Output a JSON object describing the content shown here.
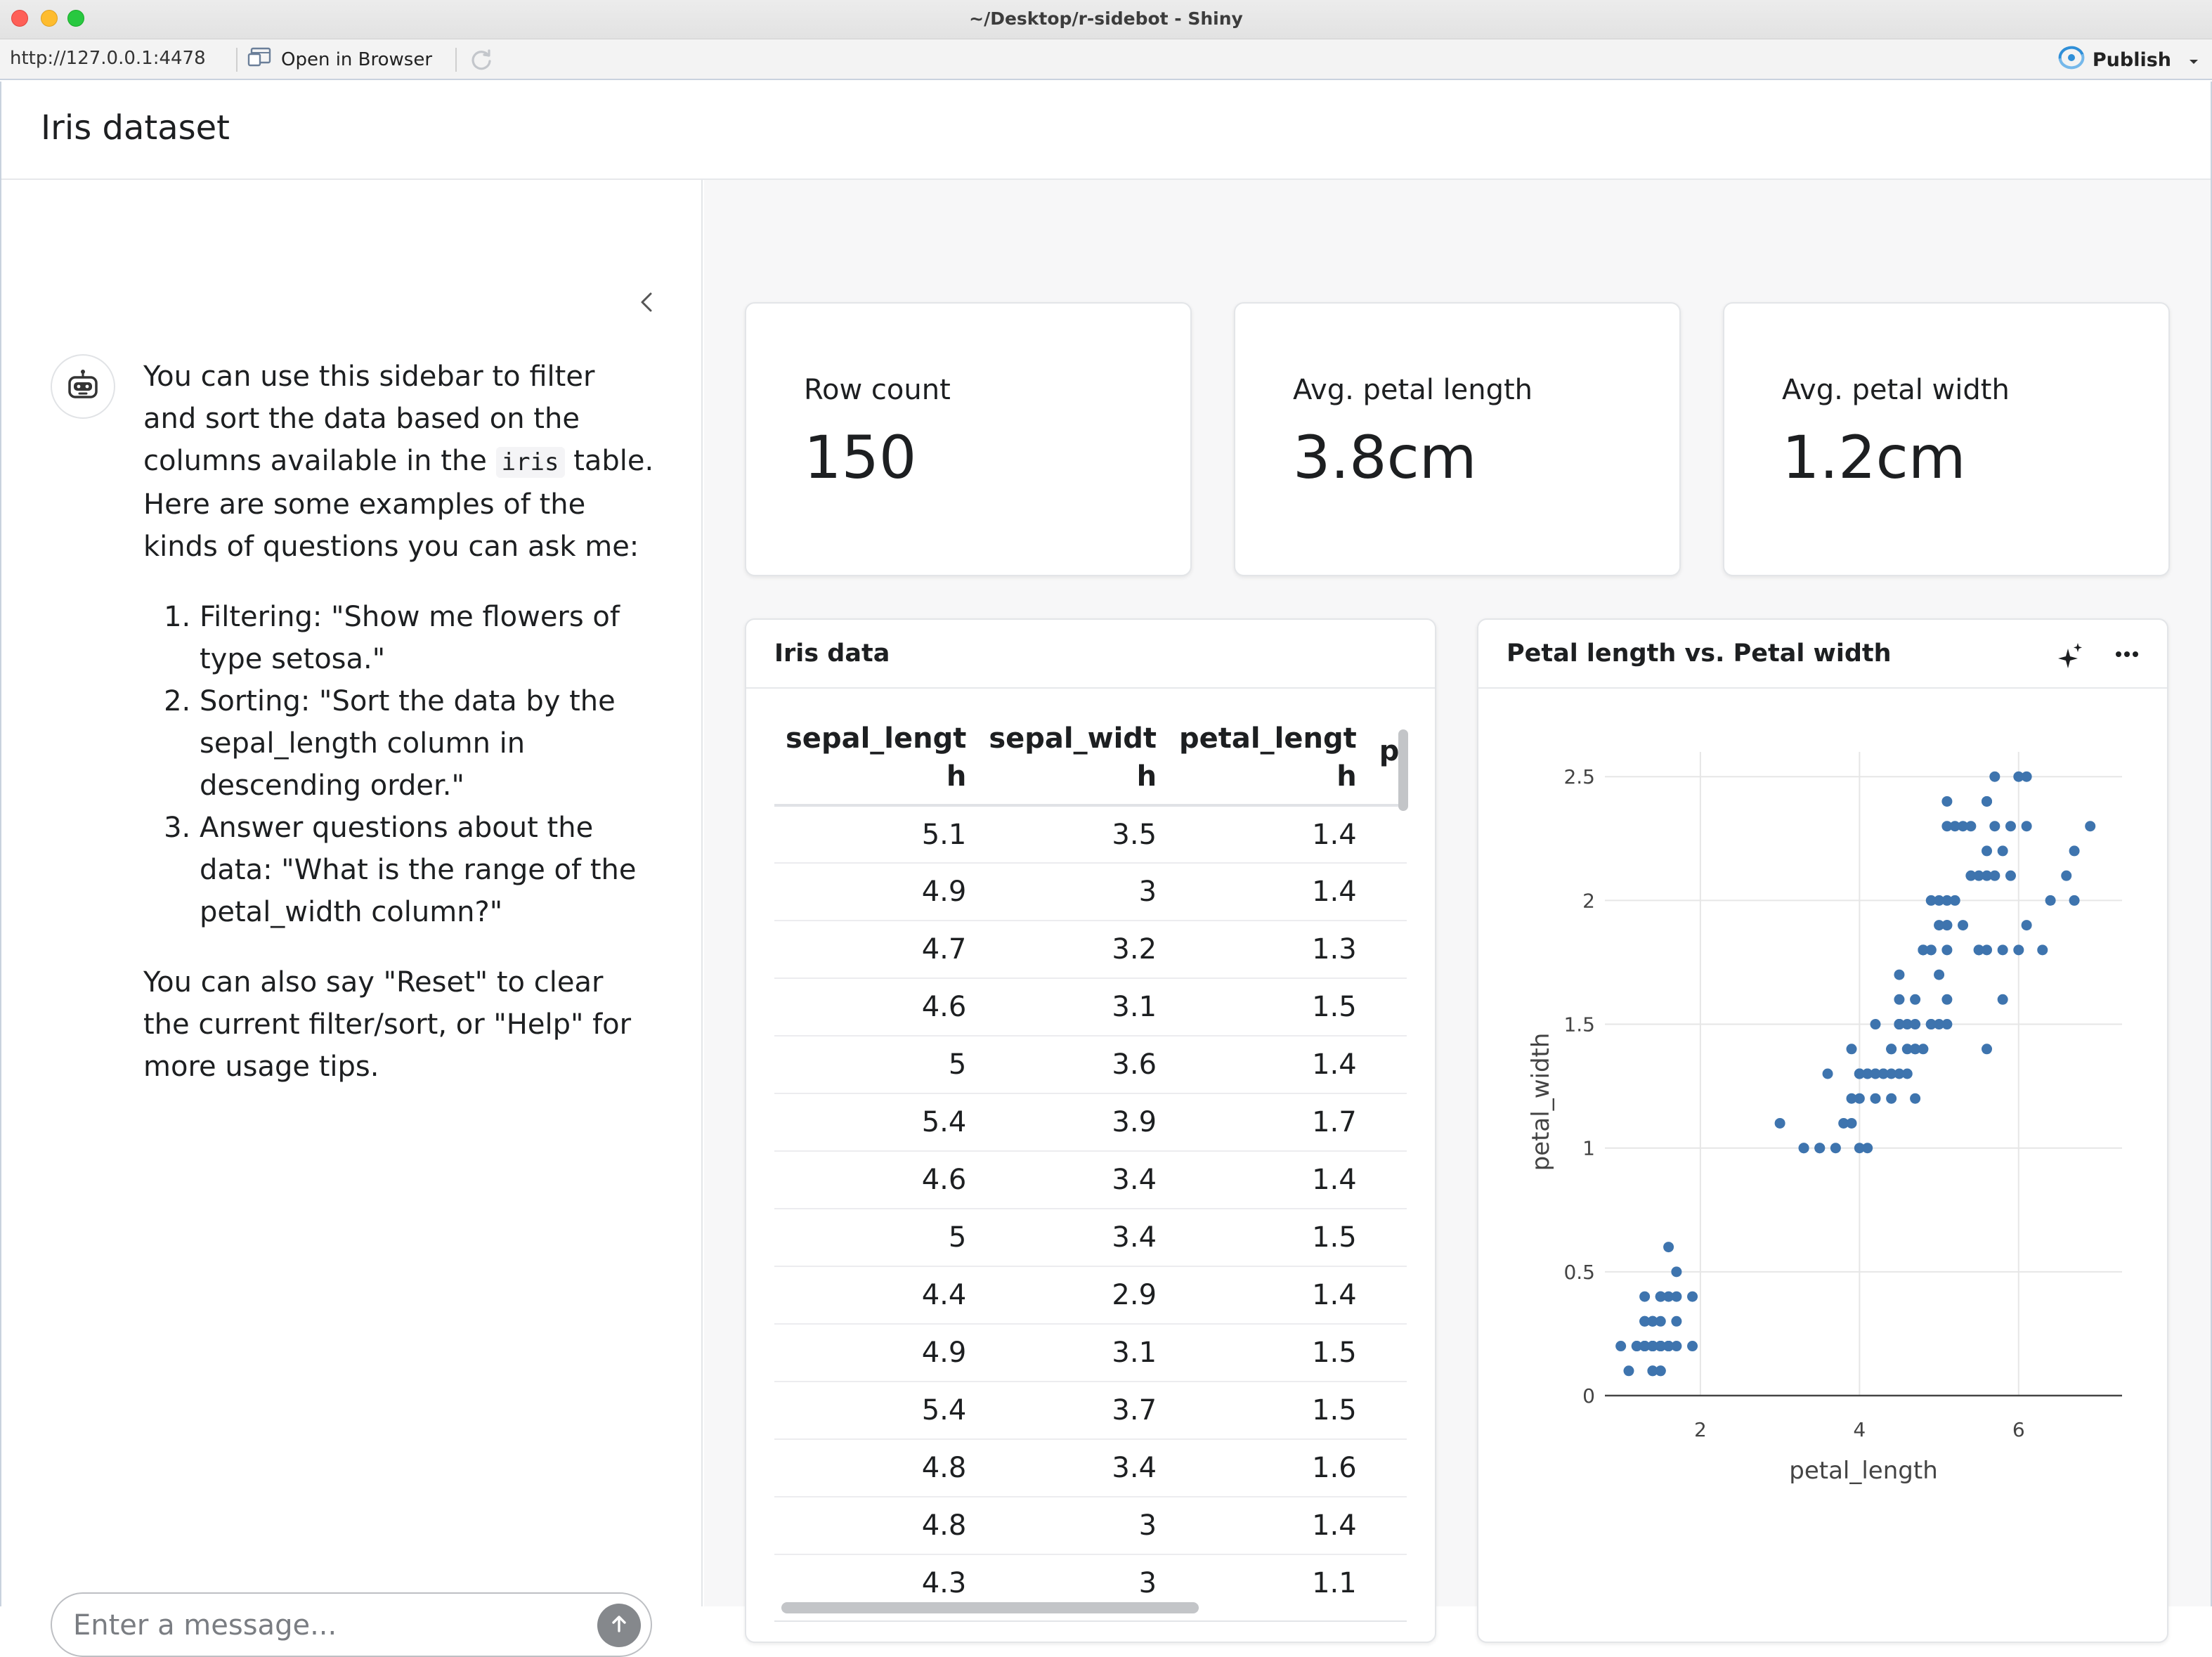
{
  "window": {
    "title": "~/Desktop/r-sidebot - Shiny"
  },
  "toolbar": {
    "url": "http://127.0.0.1:4478",
    "open_in_browser": "Open in Browser",
    "publish": "Publish"
  },
  "app": {
    "title": "Iris dataset"
  },
  "chat": {
    "intro_before": "You can use this sidebar to filter and sort the data based on the columns available in the ",
    "intro_code": "iris",
    "intro_after": " table. Here are some examples of the kinds of questions you can ask me:",
    "examples": [
      "Filtering: \"Show me flowers of type setosa.\"",
      "Sorting: \"Sort the data by the sepal_length column in descending order.\"",
      "Answer questions about the data: \"What is the range of the petal_width column?\""
    ],
    "outro": "You can also say \"Reset\" to clear the current filter/sort, or \"Help\" for more usage tips.",
    "input_placeholder": "Enter a message..."
  },
  "value_boxes": [
    {
      "label": "Row count",
      "value": "150"
    },
    {
      "label": "Avg. petal length",
      "value": "3.8cm"
    },
    {
      "label": "Avg. petal width",
      "value": "1.2cm"
    }
  ],
  "table": {
    "title": "Iris data",
    "columns": [
      "sepal_length",
      "sepal_width",
      "petal_length",
      "peta"
    ],
    "rows": [
      [
        "5.1",
        "3.5",
        "1.4"
      ],
      [
        "4.9",
        "3",
        "1.4"
      ],
      [
        "4.7",
        "3.2",
        "1.3"
      ],
      [
        "4.6",
        "3.1",
        "1.5"
      ],
      [
        "5",
        "3.6",
        "1.4"
      ],
      [
        "5.4",
        "3.9",
        "1.7"
      ],
      [
        "4.6",
        "3.4",
        "1.4"
      ],
      [
        "5",
        "3.4",
        "1.5"
      ],
      [
        "4.4",
        "2.9",
        "1.4"
      ],
      [
        "4.9",
        "3.1",
        "1.5"
      ],
      [
        "5.4",
        "3.7",
        "1.5"
      ],
      [
        "4.8",
        "3.4",
        "1.6"
      ],
      [
        "4.8",
        "3",
        "1.4"
      ],
      [
        "4.3",
        "3",
        "1.1"
      ]
    ]
  },
  "colors": {
    "point": "#3e74ae",
    "accent": "#2a8bd6"
  },
  "chart_data": {
    "type": "scatter",
    "title": "Petal length vs. Petal width",
    "xlabel": "petal_length",
    "ylabel": "petal_width",
    "xlim": [
      0.8,
      7.3
    ],
    "ylim": [
      0,
      2.6
    ],
    "xticks": [
      2,
      4,
      6
    ],
    "yticks": [
      0,
      0.5,
      1,
      1.5,
      2,
      2.5
    ],
    "grid": true,
    "points": [
      [
        1.4,
        0.2
      ],
      [
        1.4,
        0.2
      ],
      [
        1.3,
        0.2
      ],
      [
        1.5,
        0.2
      ],
      [
        1.4,
        0.2
      ],
      [
        1.7,
        0.4
      ],
      [
        1.4,
        0.3
      ],
      [
        1.5,
        0.2
      ],
      [
        1.4,
        0.2
      ],
      [
        1.5,
        0.1
      ],
      [
        1.5,
        0.2
      ],
      [
        1.6,
        0.2
      ],
      [
        1.4,
        0.1
      ],
      [
        1.1,
        0.1
      ],
      [
        1.2,
        0.2
      ],
      [
        1.5,
        0.4
      ],
      [
        1.3,
        0.4
      ],
      [
        1.4,
        0.3
      ],
      [
        1.7,
        0.3
      ],
      [
        1.5,
        0.3
      ],
      [
        1.7,
        0.2
      ],
      [
        1.5,
        0.4
      ],
      [
        1.0,
        0.2
      ],
      [
        1.7,
        0.5
      ],
      [
        1.9,
        0.2
      ],
      [
        1.6,
        0.2
      ],
      [
        1.6,
        0.4
      ],
      [
        1.5,
        0.2
      ],
      [
        1.4,
        0.2
      ],
      [
        1.6,
        0.2
      ],
      [
        1.6,
        0.2
      ],
      [
        1.5,
        0.4
      ],
      [
        1.5,
        0.1
      ],
      [
        1.4,
        0.2
      ],
      [
        1.5,
        0.2
      ],
      [
        1.2,
        0.2
      ],
      [
        1.3,
        0.2
      ],
      [
        1.4,
        0.1
      ],
      [
        1.3,
        0.2
      ],
      [
        1.5,
        0.2
      ],
      [
        1.3,
        0.3
      ],
      [
        1.3,
        0.3
      ],
      [
        1.3,
        0.2
      ],
      [
        1.6,
        0.6
      ],
      [
        1.9,
        0.4
      ],
      [
        1.4,
        0.3
      ],
      [
        1.6,
        0.2
      ],
      [
        1.4,
        0.2
      ],
      [
        1.5,
        0.2
      ],
      [
        1.4,
        0.2
      ],
      [
        4.7,
        1.4
      ],
      [
        4.5,
        1.5
      ],
      [
        4.9,
        1.5
      ],
      [
        4.0,
        1.3
      ],
      [
        4.6,
        1.5
      ],
      [
        4.5,
        1.3
      ],
      [
        4.7,
        1.6
      ],
      [
        3.3,
        1.0
      ],
      [
        4.6,
        1.3
      ],
      [
        3.9,
        1.4
      ],
      [
        3.5,
        1.0
      ],
      [
        4.2,
        1.5
      ],
      [
        4.0,
        1.0
      ],
      [
        4.7,
        1.4
      ],
      [
        3.6,
        1.3
      ],
      [
        4.4,
        1.4
      ],
      [
        4.5,
        1.5
      ],
      [
        4.1,
        1.0
      ],
      [
        4.5,
        1.5
      ],
      [
        3.9,
        1.1
      ],
      [
        4.8,
        1.8
      ],
      [
        4.0,
        1.3
      ],
      [
        4.9,
        1.5
      ],
      [
        4.7,
        1.2
      ],
      [
        4.3,
        1.3
      ],
      [
        4.4,
        1.4
      ],
      [
        4.8,
        1.4
      ],
      [
        5.0,
        1.7
      ],
      [
        4.5,
        1.5
      ],
      [
        3.5,
        1.0
      ],
      [
        3.8,
        1.1
      ],
      [
        3.7,
        1.0
      ],
      [
        3.9,
        1.2
      ],
      [
        5.1,
        1.6
      ],
      [
        4.5,
        1.5
      ],
      [
        4.5,
        1.6
      ],
      [
        4.7,
        1.5
      ],
      [
        4.4,
        1.3
      ],
      [
        4.1,
        1.3
      ],
      [
        4.0,
        1.3
      ],
      [
        4.4,
        1.2
      ],
      [
        4.6,
        1.4
      ],
      [
        4.0,
        1.2
      ],
      [
        3.3,
        1.0
      ],
      [
        4.2,
        1.3
      ],
      [
        4.2,
        1.2
      ],
      [
        4.2,
        1.3
      ],
      [
        4.3,
        1.3
      ],
      [
        3.0,
        1.1
      ],
      [
        4.1,
        1.3
      ],
      [
        6.0,
        2.5
      ],
      [
        5.1,
        1.9
      ],
      [
        5.9,
        2.1
      ],
      [
        5.6,
        1.8
      ],
      [
        5.8,
        2.2
      ],
      [
        6.6,
        2.1
      ],
      [
        4.5,
        1.7
      ],
      [
        6.3,
        1.8
      ],
      [
        5.8,
        1.8
      ],
      [
        6.1,
        2.5
      ],
      [
        5.1,
        2.0
      ],
      [
        5.3,
        1.9
      ],
      [
        5.5,
        2.1
      ],
      [
        5.0,
        2.0
      ],
      [
        5.1,
        2.4
      ],
      [
        5.3,
        2.3
      ],
      [
        5.5,
        1.8
      ],
      [
        6.7,
        2.2
      ],
      [
        6.9,
        2.3
      ],
      [
        5.0,
        1.5
      ],
      [
        5.7,
        2.3
      ],
      [
        4.9,
        2.0
      ],
      [
        6.7,
        2.0
      ],
      [
        4.9,
        1.8
      ],
      [
        5.7,
        2.1
      ],
      [
        6.0,
        1.8
      ],
      [
        4.8,
        1.8
      ],
      [
        4.9,
        1.8
      ],
      [
        5.6,
        2.1
      ],
      [
        5.8,
        1.6
      ],
      [
        6.1,
        1.9
      ],
      [
        6.4,
        2.0
      ],
      [
        5.6,
        2.2
      ],
      [
        5.1,
        1.5
      ],
      [
        5.6,
        1.4
      ],
      [
        6.1,
        2.3
      ],
      [
        5.6,
        2.4
      ],
      [
        5.5,
        1.8
      ],
      [
        4.8,
        1.8
      ],
      [
        5.4,
        2.1
      ],
      [
        5.6,
        2.4
      ],
      [
        5.1,
        2.3
      ],
      [
        5.1,
        1.9
      ],
      [
        5.9,
        2.3
      ],
      [
        5.7,
        2.5
      ],
      [
        5.2,
        2.3
      ],
      [
        5.0,
        1.9
      ],
      [
        5.2,
        2.0
      ],
      [
        5.4,
        2.3
      ],
      [
        5.1,
        1.8
      ]
    ]
  }
}
